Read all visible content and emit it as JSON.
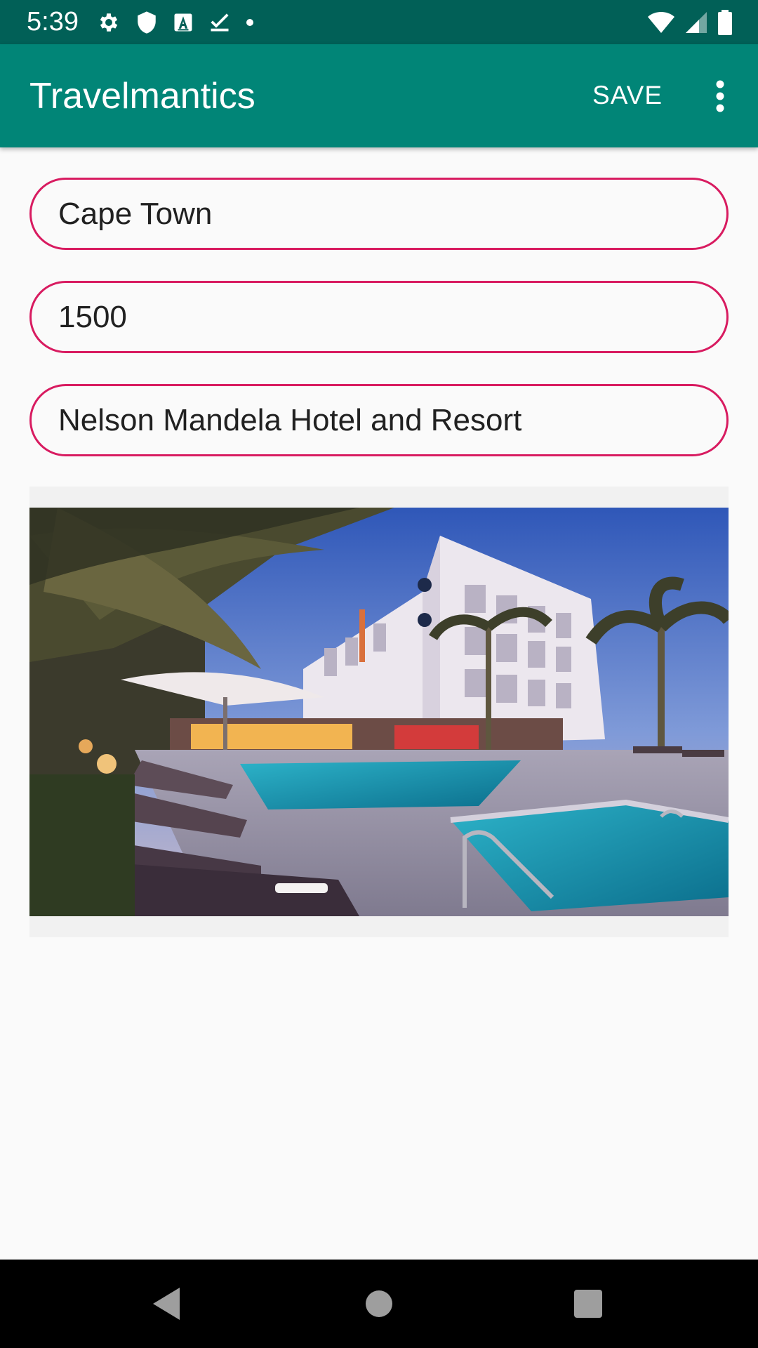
{
  "status_bar": {
    "time": "5:39",
    "left_icons": [
      "settings-icon",
      "shield-icon",
      "keyboard-a-icon",
      "download-done-icon",
      "notification-dot-icon"
    ],
    "right_icons": [
      "wifi-icon",
      "cellular-signal-icon",
      "battery-icon"
    ]
  },
  "app_bar": {
    "title": "Travelmantics",
    "save_label": "SAVE",
    "overflow_icon": "more-vert-icon"
  },
  "form": {
    "title_value": "Cape Town",
    "price_value": "1500",
    "description_value": "Nelson Mandela Hotel and Resort"
  },
  "image": {
    "subject": "hotel-resort-pool-photo"
  },
  "nav_bar": {
    "icons": [
      "back-icon",
      "home-icon",
      "recents-icon"
    ]
  },
  "colors": {
    "status_bar": "#016057",
    "app_bar": "#018577",
    "field_border": "#d81b60",
    "background": "#fafafa"
  }
}
